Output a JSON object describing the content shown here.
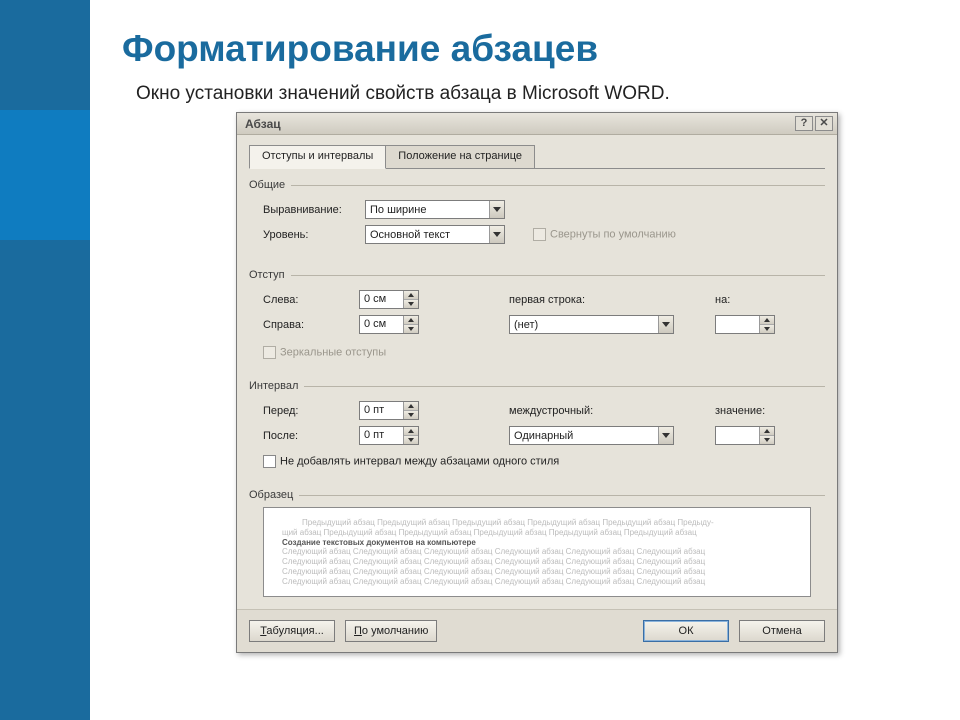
{
  "page": {
    "title": "Форматирование абзацев",
    "subtitle": "Окно установки значений свойств абзаца в Microsoft WORD."
  },
  "dialog": {
    "title": "Абзац",
    "tabs": {
      "active": "Отступы и интервалы",
      "inactive": "Положение на странице"
    },
    "groups": {
      "general": {
        "label": "Общие",
        "fields": {
          "alignment_label": "Выравнивание:",
          "alignment_value": "По ширине",
          "level_label": "Уровень:",
          "level_value": "Основной текст",
          "collapsed_label": "Свернуты по умолчанию"
        }
      },
      "indent": {
        "label": "Отступ",
        "fields": {
          "left_label": "Слева:",
          "left_value": "0 см",
          "right_label": "Справа:",
          "right_value": "0 см",
          "first_line_label": "первая строка:",
          "first_line_value": "(нет)",
          "by_label": "на:",
          "by_value": "",
          "mirror_label": "Зеркальные отступы"
        }
      },
      "spacing": {
        "label": "Интервал",
        "fields": {
          "before_label": "Перед:",
          "before_value": "0 пт",
          "after_label": "После:",
          "after_value": "0 пт",
          "line_label": "междустрочный:",
          "line_value": "Одинарный",
          "at_label": "значение:",
          "at_value": "",
          "no_space_label": "Не добавлять интервал между абзацами одного стиля"
        }
      },
      "sample": {
        "label": "Образец",
        "lines": {
          "prev": "Предыдущий абзац Предыдущий абзац Предыдущий абзац Предыдущий абзац Предыдущий абзац Предыду-",
          "prev2": "щий абзац Предыдущий абзац Предыдущий абзац Предыдущий абзац Предыдущий абзац Предыдущий абзац",
          "main": "Создание текстовых документов на компьютере",
          "next": "Следующий абзац Следующий абзац Следующий абзац Следующий абзац Следующий абзац Следующий абзац",
          "next2": "Следующий абзац Следующий абзац Следующий абзац Следующий абзац Следующий абзац Следующий абзац",
          "next3": "Следующий абзац Следующий абзац Следующий абзац Следующий абзац Следующий абзац Следующий абзац",
          "next4": "Следующий абзац Следующий абзац Следующий абзац Следующий абзац Следующий абзац Следующий абзац"
        }
      }
    },
    "buttons": {
      "tabs": "Табуляция...",
      "default": "По умолчанию",
      "ok": "ОК",
      "cancel": "Отмена"
    }
  }
}
